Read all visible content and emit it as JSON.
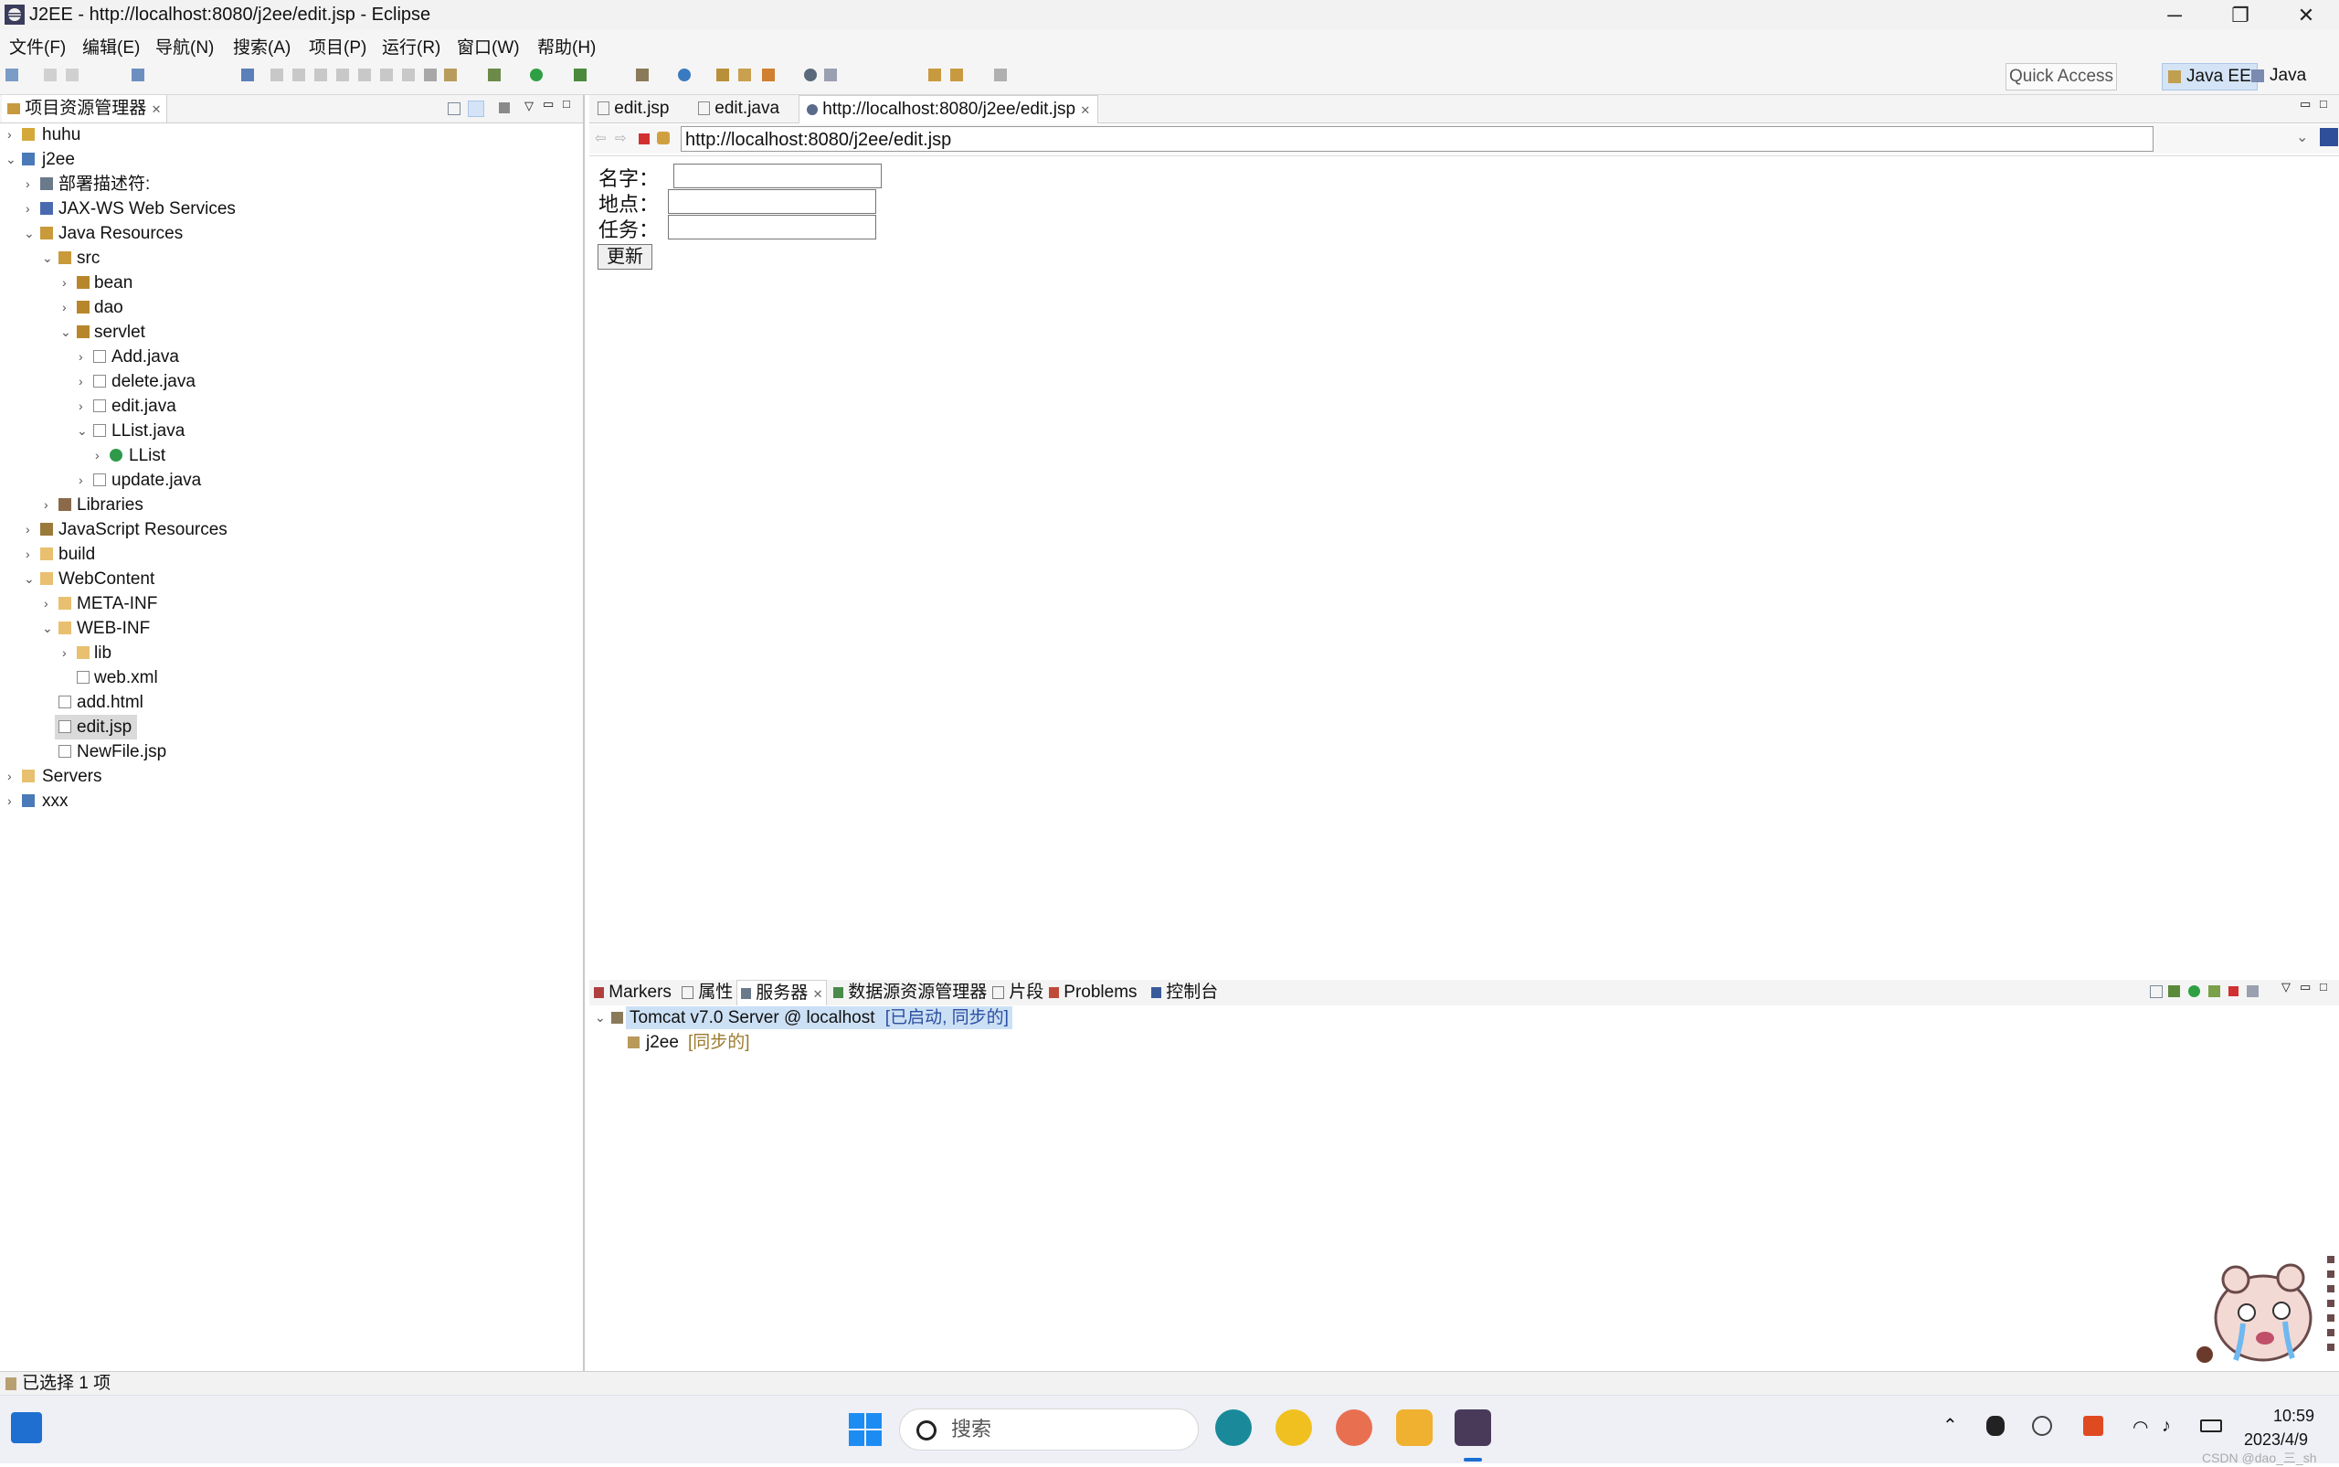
{
  "window": {
    "title": "J2EE - http://localhost:8080/j2ee/edit.jsp - Eclipse",
    "minimize": "─",
    "restore": "❐",
    "close": "✕"
  },
  "menu": [
    "文件(F)",
    "编辑(E)",
    "导航(N)",
    "搜索(A)",
    "项目(P)",
    "运行(R)",
    "窗口(W)",
    "帮助(H)"
  ],
  "toolbar": {
    "quick_access": "Quick Access",
    "perspectives": [
      {
        "label": "Java EE",
        "active": true
      },
      {
        "label": "Java",
        "active": false
      }
    ]
  },
  "project_explorer": {
    "tab_label": "项目资源管理器",
    "tree": [
      {
        "label": "huhu",
        "icon": "project-icon",
        "expanded": false
      },
      {
        "label": "j2ee",
        "icon": "project-icon",
        "expanded": true
      },
      {
        "label": "部署描述符:",
        "icon": "descriptor-icon",
        "expanded": false
      },
      {
        "label": "JAX-WS Web Services",
        "icon": "webservice-icon",
        "expanded": false
      },
      {
        "label": "Java Resources",
        "icon": "java-resources-icon",
        "expanded": true
      },
      {
        "label": "src",
        "icon": "source-folder-icon",
        "expanded": true
      },
      {
        "label": "bean",
        "icon": "package-icon",
        "expanded": false
      },
      {
        "label": "dao",
        "icon": "package-icon",
        "expanded": false
      },
      {
        "label": "servlet",
        "icon": "package-icon",
        "expanded": true
      },
      {
        "label": "Add.java",
        "icon": "java-file-icon",
        "expanded": false
      },
      {
        "label": "delete.java",
        "icon": "java-file-icon",
        "expanded": false
      },
      {
        "label": "edit.java",
        "icon": "java-file-icon",
        "expanded": false
      },
      {
        "label": "LList.java",
        "icon": "java-file-icon",
        "expanded": true
      },
      {
        "label": "LList",
        "icon": "class-icon",
        "expanded": false
      },
      {
        "label": "update.java",
        "icon": "java-file-icon",
        "expanded": false
      },
      {
        "label": "Libraries",
        "icon": "library-icon",
        "expanded": false
      },
      {
        "label": "JavaScript Resources",
        "icon": "js-resources-icon",
        "expanded": false
      },
      {
        "label": "build",
        "icon": "folder-icon",
        "expanded": false
      },
      {
        "label": "WebContent",
        "icon": "folder-icon",
        "expanded": true
      },
      {
        "label": "META-INF",
        "icon": "folder-icon",
        "expanded": false
      },
      {
        "label": "WEB-INF",
        "icon": "folder-icon",
        "expanded": true
      },
      {
        "label": "lib",
        "icon": "folder-icon",
        "expanded": false
      },
      {
        "label": "web.xml",
        "icon": "xml-file-icon",
        "expanded": false
      },
      {
        "label": "add.html",
        "icon": "html-file-icon",
        "expanded": false
      },
      {
        "label": "edit.jsp",
        "icon": "jsp-file-icon",
        "expanded": false,
        "selected": true
      },
      {
        "label": "NewFile.jsp",
        "icon": "jsp-file-icon",
        "expanded": false
      },
      {
        "label": "Servers",
        "icon": "folder-icon",
        "expanded": false
      },
      {
        "label": "xxx",
        "icon": "project-icon",
        "expanded": false
      }
    ]
  },
  "editor": {
    "tabs": [
      {
        "label": "edit.jsp",
        "active": false
      },
      {
        "label": "edit.java",
        "active": false
      },
      {
        "label": "http://localhost:8080/j2ee/edit.jsp",
        "active": true
      }
    ],
    "url": "http://localhost:8080/j2ee/edit.jsp",
    "form": {
      "name_label": "名字：",
      "place_label": "地点：",
      "task_label": "任务：",
      "submit_label": "更新"
    }
  },
  "bottom_panel": {
    "tabs": [
      {
        "label": "Markers",
        "active": false
      },
      {
        "label": "属性",
        "active": false
      },
      {
        "label": "服务器",
        "active": true
      },
      {
        "label": "数据源资源管理器",
        "active": false
      },
      {
        "label": "片段",
        "active": false
      },
      {
        "label": "Problems",
        "active": false
      },
      {
        "label": "控制台",
        "active": false
      }
    ],
    "server": {
      "name": "Tomcat v7.0 Server @ localhost",
      "state": "[已启动, 同步的]",
      "module": "j2ee",
      "module_state": "[同步的]"
    }
  },
  "status": {
    "text": "已选择 1 项"
  },
  "taskbar": {
    "search_placeholder": "搜索",
    "time": "10:59",
    "date": "2023/4/9",
    "watermark": "CSDN @dao_三_sh"
  },
  "colors": {
    "selection": "#dadada",
    "perspective_active": "#d4e4f6",
    "server_selected": "#cce0f5",
    "server_state": "#2a4ea0",
    "module_state": "#9a7a2c"
  }
}
